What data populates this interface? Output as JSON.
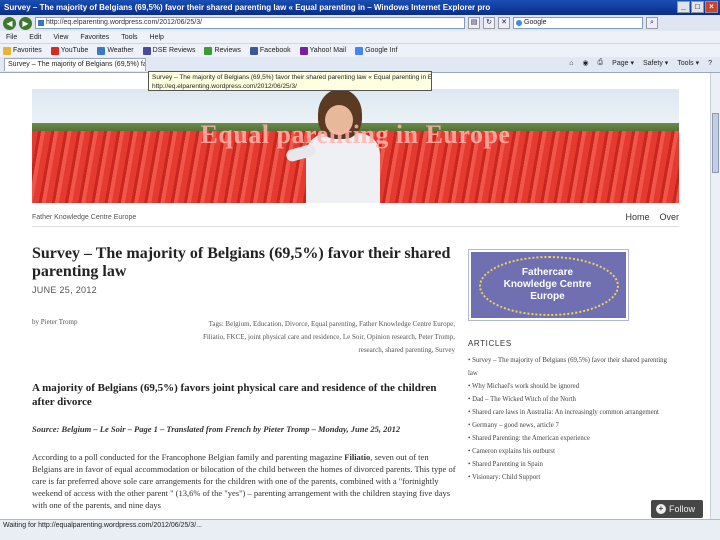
{
  "window": {
    "title": "Survey – The majority of Belgians (69,5%) favor their shared parenting law « Equal parenting in – Windows Internet Explorer pro"
  },
  "address_bar": {
    "url": "http://eq.elparenting.wordpress.com/2012/06/25/3/",
    "search_value": "Google"
  },
  "menu": [
    "File",
    "Edit",
    "View",
    "Favorites",
    "Tools",
    "Help"
  ],
  "favorites_bar": {
    "items": [
      {
        "label": "Favorites",
        "color": "#e7b52f"
      },
      {
        "label": "YouTube",
        "color": "#d9281f"
      },
      {
        "label": "Weather",
        "color": "#3a78c8"
      },
      {
        "label": "DSE Reviews",
        "color": "#4a4a9e"
      },
      {
        "label": "Reviews",
        "color": "#3b9b3b"
      },
      {
        "label": "Facebook",
        "color": "#3b5998"
      },
      {
        "label": "Yahoo! Mail",
        "color": "#7b1fa2"
      },
      {
        "label": "Google Inf",
        "color": "#4285f4"
      }
    ]
  },
  "tab": {
    "label": "Survey – The majority of Belgians (69,5%) favor their..."
  },
  "toolbar_tools": [
    "Page ▾",
    "Safety ▾",
    "Tools ▾"
  ],
  "tooltip": {
    "line1": "Survey – The majority of Belgians (69,5%) favor their shared parenting law « Equal parenting in Europe",
    "line2": "http://eq.elparenting.wordpress.com/2012/06/25/3/"
  },
  "site": {
    "title": "Equal parenting in Europe",
    "tagline": "Father Knowledge Centre Europe",
    "nav": [
      "Home",
      "Over"
    ]
  },
  "post": {
    "title": "Survey – The majority of Belgians (69,5%) favor their shared parenting law",
    "date": "JUNE 25, 2012",
    "byline": "by Pieter Tromp",
    "categories": "Tags: Belgium, Education, Divorce, Equal parenting, Father Knowledge Centre Europe, Filiatio, FKCE, joint physical care and residence, Le Soir, Opinion research, Peter Tromp, research, shared parenting, Survey",
    "subheading": "A majority of Belgians (69,5%) favors joint physical care and residence of the children after divorce",
    "source": "Source: Belgium – Le Soir – Page 1 – Translated from French by Pieter Tromp – Monday, June 25, 2012",
    "body_intro": "According to a poll conducted for the Francophone Belgian family and parenting magazine ",
    "body_magazine": "Filiatio",
    "body_rest": ", seven out of ten Belgians are in favor of equal accommodation or bilocation of the child between the homes of divorced parents. This type of care is far preferred above sole care arrangements for the children with one of the parents, combined with a \"fortnightly weekend of access with the other parent \" (13,6% of the \"yes\") – parenting arrangement with the children staying five days with one of the parents, and nine days"
  },
  "sidebar": {
    "logo_lines": [
      "Fathercare",
      "Knowledge Centre",
      "Europe"
    ],
    "articles_heading": "ARTICLES",
    "articles": [
      "Survey – The majority of Belgians (69,5%) favor their shared parenting law",
      "Why Michael's work should be ignored",
      "Dad – The Wicked Witch of the North",
      "Shared care laws in Australia: An increasingly common arrangement",
      "Germany – good news, article 7",
      "Shared Parenting: the American experience",
      "Cameron explains his outburst",
      "Shared Parenting in Spain",
      "Visionary: Child Support"
    ]
  },
  "follow_button": {
    "label": "Follow"
  },
  "status_bar": {
    "text": "Waiting for http://equalparenting.wordpress.com/2012/06/25/3/..."
  }
}
